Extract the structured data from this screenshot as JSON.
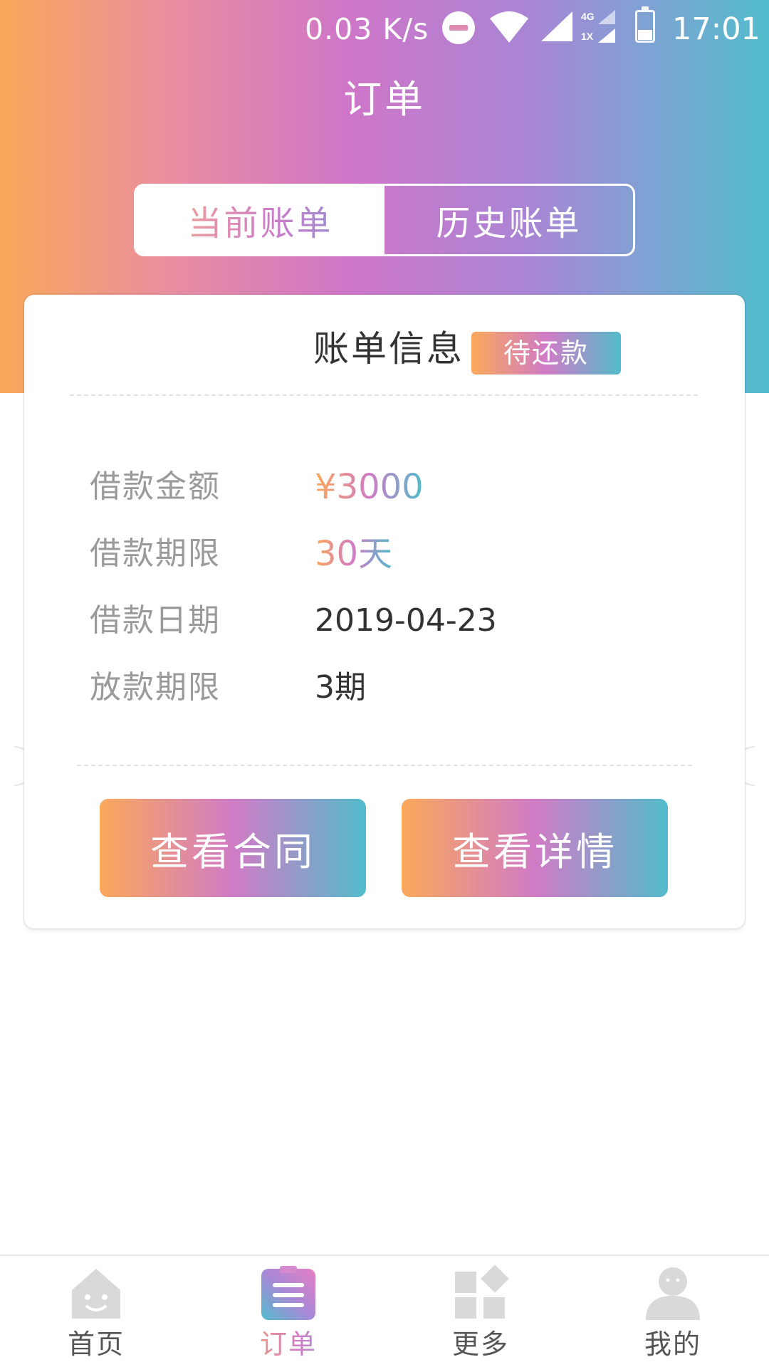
{
  "status_bar": {
    "net_speed": "0.03 K/s",
    "time": "17:01",
    "net_type_top": "4G",
    "net_type_bottom": "1X",
    "icons": [
      "dnd-icon",
      "wifi-icon",
      "signal-icon",
      "net-type-icon",
      "battery-icon"
    ]
  },
  "header": {
    "title": "订单"
  },
  "tabs": [
    {
      "label": "当前账单",
      "active": true
    },
    {
      "label": "历史账单",
      "active": false
    }
  ],
  "card": {
    "title": "账单信息",
    "status_badge": "待还款",
    "rows": [
      {
        "label": "借款金额",
        "value": "¥3000"
      },
      {
        "label": "借款期限",
        "value": "30天"
      },
      {
        "label": "借款日期",
        "value": "2019-04-23"
      },
      {
        "label": "放款期限",
        "value": "3期"
      }
    ],
    "buttons": {
      "contract": "查看合同",
      "detail": "查看详情"
    }
  },
  "bottom_nav": [
    {
      "label": "首页",
      "icon": "home-icon",
      "active": false
    },
    {
      "label": "订单",
      "icon": "orders-icon",
      "active": true
    },
    {
      "label": "更多",
      "icon": "more-icon",
      "active": false
    },
    {
      "label": "我的",
      "icon": "profile-icon",
      "active": false
    }
  ],
  "colors": {
    "gradient_start": "#fba85a",
    "gradient_mid": "#d07bc6",
    "gradient_end": "#52bccb",
    "label_gray": "#9a9a9a",
    "text_dark": "#333333"
  }
}
